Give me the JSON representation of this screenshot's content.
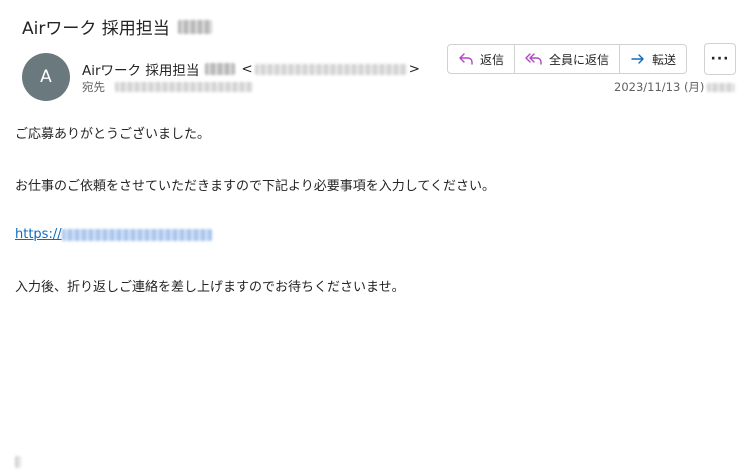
{
  "email": {
    "subject": "Airワーク 採用担当",
    "sender_name": "Airワーク 採用担当",
    "sender_email_open": "<",
    "sender_email_close": ">",
    "avatar_initial": "A",
    "to_label": "宛先",
    "date": "2023/11/13 (月)"
  },
  "actions": {
    "reply": "返信",
    "reply_all": "全員に返信",
    "forward": "転送",
    "more": "···"
  },
  "body": {
    "line1": "ご応募ありがとうございました。",
    "line2": "お仕事のご依頼をさせていただきますので下記より必要事項を入力してください。",
    "link_prefix": "https://",
    "line4": "入力後、折り返しご連絡を差し上げますのでお待ちくださいませ。"
  },
  "colors": {
    "reply_icon": "#b146c2",
    "forward_icon": "#0f6cbd",
    "link": "#0f6cbd",
    "avatar_bg": "#69797e"
  }
}
